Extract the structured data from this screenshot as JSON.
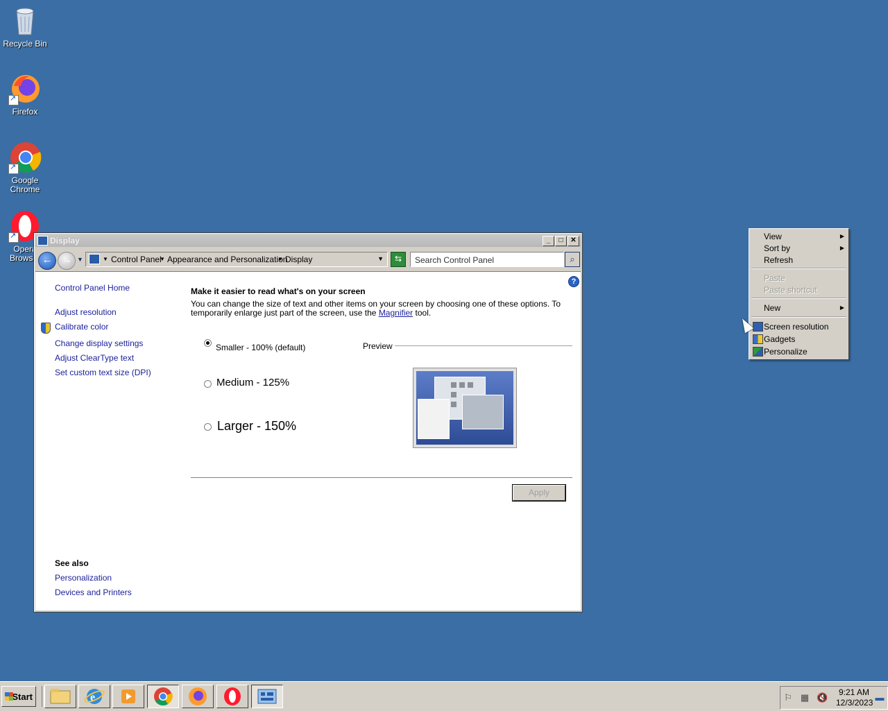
{
  "desktop": {
    "icons": [
      {
        "label": "Recycle Bin"
      },
      {
        "label": "Firefox"
      },
      {
        "label": "Google Chrome"
      },
      {
        "label": "Opera Browser"
      }
    ]
  },
  "window": {
    "title": "Display",
    "address": {
      "crumbs": [
        "Control Panel",
        "Appearance and Personalization",
        "Display"
      ]
    },
    "search_placeholder": "Search Control Panel",
    "sidebar": {
      "home": "Control Panel Home",
      "links": [
        "Adjust resolution",
        "Calibrate color",
        "Change display settings",
        "Adjust ClearType text",
        "Set custom text size (DPI)"
      ],
      "see_also_heading": "See also",
      "see_also": [
        "Personalization",
        "Devices and Printers"
      ]
    },
    "main": {
      "heading": "Make it easier to read what's on your screen",
      "desc_before": "You can change the size of text and other items on your screen by choosing one of these options. To temporarily enlarge just part of the screen, use the ",
      "desc_link": "Magnifier",
      "desc_after": " tool.",
      "options": [
        {
          "label": "Smaller - 100% (default)",
          "checked": true
        },
        {
          "label": "Medium - 125%",
          "checked": false
        },
        {
          "label": "Larger - 150%",
          "checked": false
        }
      ],
      "preview_label": "Preview",
      "apply_label": "Apply"
    }
  },
  "context_menu": {
    "items": [
      {
        "label": "View",
        "submenu": true,
        "enabled": true
      },
      {
        "label": "Sort by",
        "submenu": true,
        "enabled": true
      },
      {
        "label": "Refresh",
        "submenu": false,
        "enabled": true
      },
      {
        "label": "Paste",
        "submenu": false,
        "enabled": false
      },
      {
        "label": "Paste shortcut",
        "submenu": false,
        "enabled": false
      },
      {
        "label": "New",
        "submenu": true,
        "enabled": true
      },
      {
        "label": "Screen resolution",
        "submenu": false,
        "enabled": true
      },
      {
        "label": "Gadgets",
        "submenu": false,
        "enabled": true
      },
      {
        "label": "Personalize",
        "submenu": false,
        "enabled": true
      }
    ]
  },
  "taskbar": {
    "start_label": "Start",
    "apps": [
      "file-explorer-icon",
      "internet-explorer-icon",
      "media-player-icon",
      "chrome-icon",
      "firefox-icon",
      "opera-icon",
      "control-panel-icon"
    ],
    "clock_time": "9:21 AM",
    "clock_date": "12/3/2023"
  },
  "colors": {
    "desktop": "#3a6ea5",
    "link": "#1a1e9a"
  }
}
